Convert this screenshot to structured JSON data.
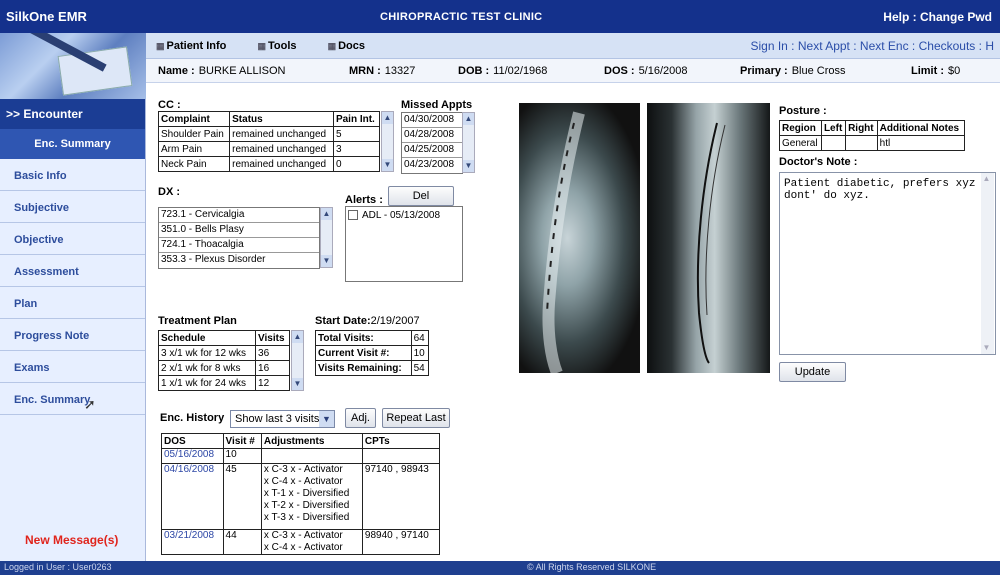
{
  "app": {
    "brand": "SilkOne  EMR",
    "clinic": "CHIROPRACTIC TEST CLINIC",
    "help": "Help",
    "sep": " : ",
    "change_pwd": "Change Pwd"
  },
  "sidebar": {
    "encounter": ">> Encounter",
    "enc_summary_header": "Enc. Summary",
    "items": [
      {
        "label": "Basic Info"
      },
      {
        "label": "Subjective"
      },
      {
        "label": "Objective"
      },
      {
        "label": "Assessment"
      },
      {
        "label": "Plan"
      },
      {
        "label": "Progress Note"
      },
      {
        "label": "Exams"
      },
      {
        "label": "Enc. Summary"
      }
    ],
    "new_messages": "New Message(s)"
  },
  "menubar": {
    "patient_info": "Patient Info",
    "tools": "Tools",
    "docs": "Docs"
  },
  "navlinks": {
    "sign_in": "Sign In",
    "next_appt": "Next Appt",
    "next_enc": "Next Enc",
    "checkouts": "Checkouts",
    "sep": " : ",
    "trail": "H"
  },
  "patient": {
    "name_label": "Name :",
    "name": "BURKE ALLISON",
    "mrn_label": "MRN :",
    "mrn": "13327",
    "dob_label": "DOB :",
    "dob": "11/02/1968",
    "dos_label": "DOS :",
    "dos": "5/16/2008",
    "primary_label": "Primary :",
    "primary": "Blue Cross",
    "limit_label": "Limit :",
    "limit": "$0"
  },
  "cc": {
    "label": "CC :",
    "headers": [
      "Complaint",
      "Status",
      "Pain Int."
    ],
    "rows": [
      [
        "Shoulder Pain",
        "remained unchanged",
        "5"
      ],
      [
        "Arm Pain",
        "remained unchanged",
        "3"
      ],
      [
        "Neck Pain",
        "remained unchanged",
        "0"
      ]
    ]
  },
  "missed": {
    "label": "Missed Appts",
    "items": [
      "04/30/2008",
      "04/28/2008",
      "04/25/2008",
      "04/23/2008"
    ]
  },
  "dx": {
    "label": "DX :",
    "items": [
      "723.1 - Cervicalgia",
      "351.0 - Bells Plasy",
      "724.1 - Thoacalgia",
      "353.3 - Plexus Disorder"
    ]
  },
  "alerts": {
    "label": "Alerts :",
    "del": "Del",
    "items": [
      "ADL - 05/13/2008"
    ]
  },
  "treatment": {
    "label": "Treatment Plan",
    "headers": [
      "Schedule",
      "Visits"
    ],
    "rows": [
      [
        "3 x/1 wk for 12 wks",
        "36"
      ],
      [
        "2 x/1 wk for 8 wks",
        "16"
      ],
      [
        "1 x/1 wk for 24 wks",
        "12"
      ]
    ]
  },
  "start": {
    "label": "Start Date:",
    "date": "2/19/2007",
    "rows": [
      [
        "Total Visits:",
        "64"
      ],
      [
        "Current Visit #:",
        "10"
      ],
      [
        "Visits Remaining:",
        "54"
      ]
    ]
  },
  "history": {
    "label": "Enc. History",
    "select": "Show last 3 visits",
    "adj": "Adj.",
    "repeat": "Repeat Last",
    "headers": [
      "DOS",
      "Visit #",
      "Adjustments",
      "CPTs"
    ],
    "rows": [
      {
        "dos": "05/16/2008",
        "visit": "10",
        "adj": [],
        "cpts": ""
      },
      {
        "dos": "04/16/2008",
        "visit": "45",
        "adj": [
          "x  C-3  x - Activator",
          "x  C-4  x - Activator",
          "x  T-1  x - Diversified",
          "x  T-2  x - Diversified",
          "x  T-3  x - Diversified"
        ],
        "cpts": "97140 , 98943"
      },
      {
        "dos": "03/21/2008",
        "visit": "44",
        "adj": [
          "x  C-3  x - Activator",
          "x  C-4  x - Activator"
        ],
        "cpts": "98940 , 97140"
      }
    ]
  },
  "posture": {
    "label": "Posture :",
    "headers": [
      "Region",
      "Left",
      "Right",
      "Additional Notes"
    ],
    "rows": [
      [
        "General",
        "",
        "",
        "htl"
      ]
    ]
  },
  "doctors_note": {
    "label": "Doctor's Note :",
    "text": "Patient diabetic, prefers xyz\ndont' do xyz.",
    "update": "Update"
  },
  "footer": {
    "logged_in": "Logged in User : User0263",
    "rights": "© All Rights Reserved  SILKONE"
  }
}
